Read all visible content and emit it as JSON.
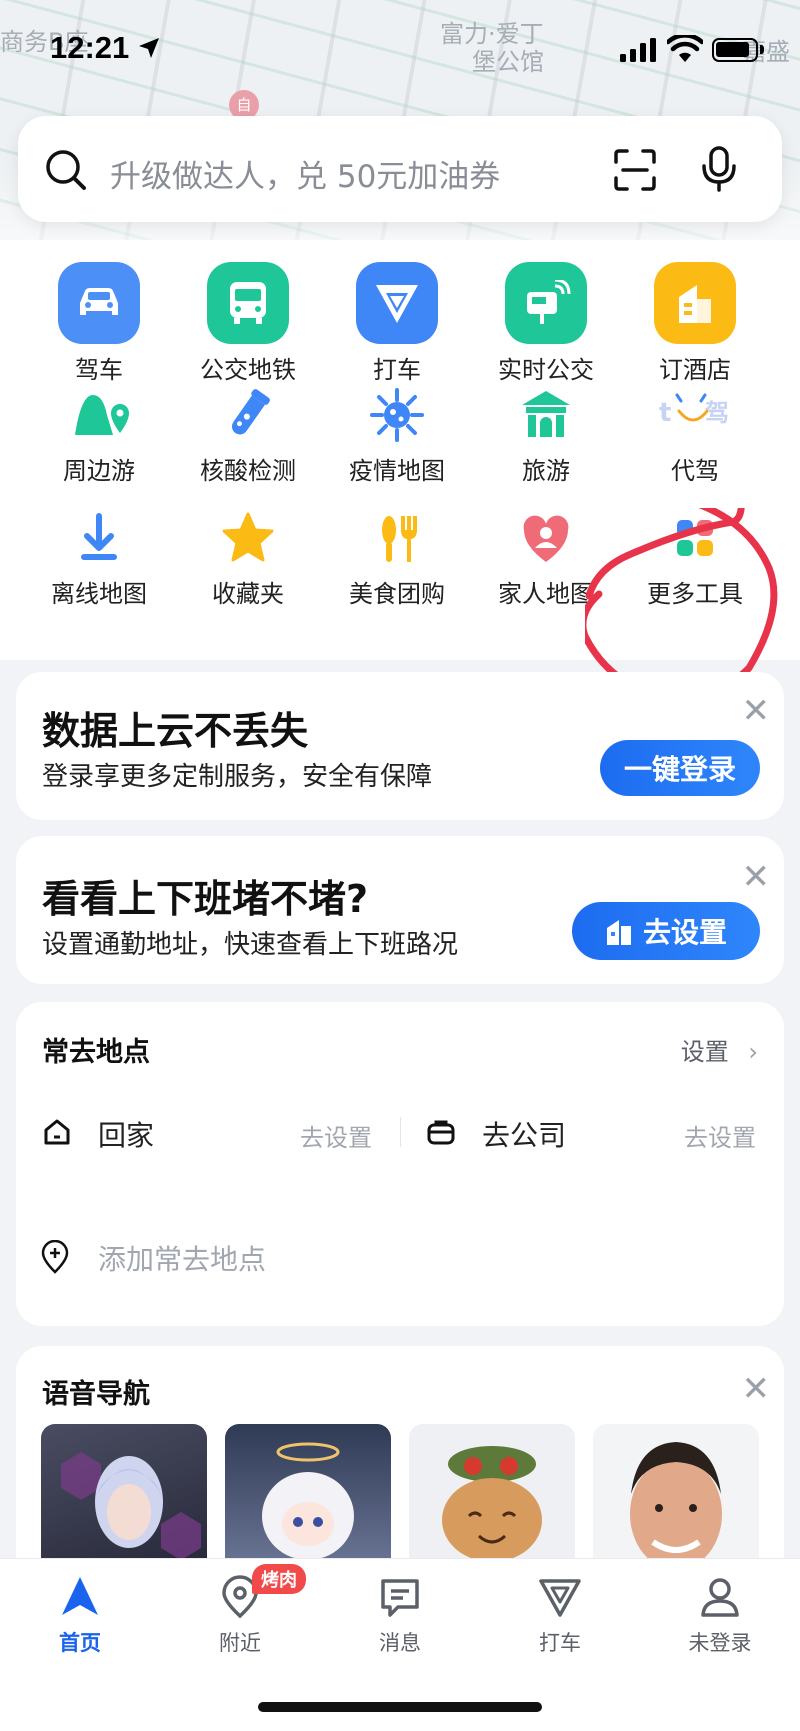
{
  "status_bar": {
    "time": "12:21"
  },
  "map": {
    "labels": [
      "商务B座",
      "富力·爱丁",
      "堡公馆",
      "嘉盛"
    ],
    "pin": "自"
  },
  "search": {
    "placeholder": "升级做达人，兑 50元加油券"
  },
  "grid": {
    "row1": [
      {
        "label": "驾车",
        "icon": "car-icon",
        "color": "#4b8ff7"
      },
      {
        "label": "公交地铁",
        "icon": "bus-icon",
        "color": "#1fc798"
      },
      {
        "label": "打车",
        "icon": "taxi-icon",
        "color": "#3f86f6"
      },
      {
        "label": "实时公交",
        "icon": "realtime-bus-icon",
        "color": "#1fc798"
      },
      {
        "label": "订酒店",
        "icon": "hotel-icon",
        "color": "#fbbb14"
      }
    ],
    "row2": [
      {
        "label": "周边游",
        "icon": "nearby-tour-icon"
      },
      {
        "label": "核酸检测",
        "icon": "test-tube-icon"
      },
      {
        "label": "疫情地图",
        "icon": "virus-icon"
      },
      {
        "label": "旅游",
        "icon": "travel-icon"
      },
      {
        "label": "代驾",
        "icon": "designated-driver-icon"
      }
    ],
    "row3": [
      {
        "label": "离线地图",
        "icon": "download-icon"
      },
      {
        "label": "收藏夹",
        "icon": "star-icon"
      },
      {
        "label": "美食团购",
        "icon": "food-icon"
      },
      {
        "label": "家人地图",
        "icon": "family-map-icon"
      },
      {
        "label": "更多工具",
        "icon": "more-tools-icon"
      }
    ]
  },
  "cloud_card": {
    "title": "数据上云不丢失",
    "subtitle": "登录享更多定制服务，安全有保障",
    "button": "一键登录"
  },
  "commute_card": {
    "title": "看看上下班堵不堵?",
    "subtitle": "设置通勤地址，快速查看上下班路况",
    "button": "去设置"
  },
  "favorites": {
    "title": "常去地点",
    "settings": "设置",
    "home": "回家",
    "home_hint": "去设置",
    "company": "去公司",
    "company_hint": "去设置",
    "add": "添加常去地点"
  },
  "voice_nav": {
    "title": "语音导航"
  },
  "tabs": [
    {
      "label": "首页",
      "icon": "home-nav-icon",
      "active": true
    },
    {
      "label": "附近",
      "icon": "nearby-icon"
    },
    {
      "label": "消息",
      "icon": "message-icon"
    },
    {
      "label": "打车",
      "icon": "taxi-tab-icon"
    },
    {
      "label": "未登录",
      "icon": "user-icon"
    }
  ],
  "tab_badge": "烤肉",
  "colors": {
    "accent": "#1a63ef",
    "green": "#1fc798",
    "annotation": "#e8344a"
  }
}
